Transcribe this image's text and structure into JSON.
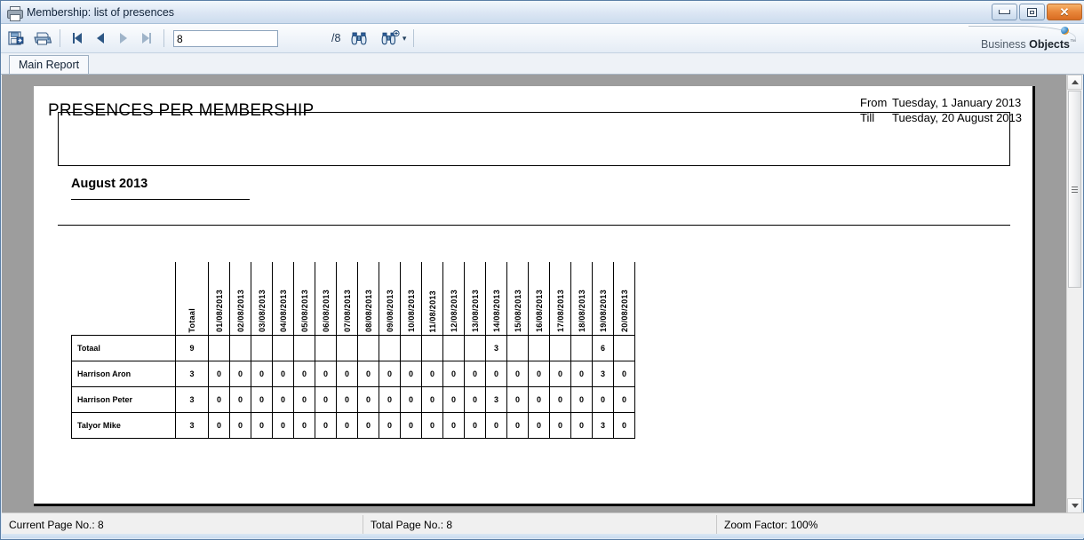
{
  "window": {
    "title": "Membership: list of presences",
    "icon": "printer-icon",
    "minimize_label": "Minimize",
    "maximize_label": "Maximize",
    "close_label": "Close"
  },
  "toolbar": {
    "export_label": "Export Report",
    "print_label": "Print Report",
    "first_page_label": "Go To First Page",
    "prev_page_label": "Go To Previous Page",
    "next_page_label": "Go To Next Page",
    "last_page_label": "Go To Last Page",
    "page_value": "8",
    "page_placeholder": "",
    "page_total": "/8",
    "search_label": "Search Text",
    "zoom_label": "Zoom",
    "zoom_caret": "▾",
    "brand_first": "Business ",
    "brand_second": "Objects",
    "brand_tm": "™"
  },
  "tabs": [
    {
      "label": "Main Report",
      "active": true
    }
  ],
  "report": {
    "title": "PRESENCES PER MEMBERSHIP",
    "from_label": "From",
    "from_value": "Tuesday, 1 January 2013",
    "till_label": "Till",
    "till_value": "Tuesday, 20 August 2013",
    "month_heading": "August 2013"
  },
  "table": {
    "row_header_label": "",
    "total_column": "Totaal",
    "date_columns": [
      "01/08/2013",
      "02/08/2013",
      "03/08/2013",
      "04/08/2013",
      "05/08/2013",
      "06/08/2013",
      "07/08/2013",
      "08/08/2013",
      "09/08/2013",
      "10/08/2013",
      "11/08/2013",
      "12/08/2013",
      "13/08/2013",
      "14/08/2013",
      "15/08/2013",
      "16/08/2013",
      "17/08/2013",
      "18/08/2013",
      "19/08/2013",
      "20/08/2013"
    ],
    "rows": [
      {
        "name": "Totaal",
        "total": "9",
        "values": [
          "",
          "",
          "",
          "",
          "",
          "",
          "",
          "",
          "",
          "",
          "",
          "",
          "",
          "3",
          "",
          "",
          "",
          "",
          "6",
          ""
        ]
      },
      {
        "name": "Harrison  Aron",
        "total": "3",
        "values": [
          "0",
          "0",
          "0",
          "0",
          "0",
          "0",
          "0",
          "0",
          "0",
          "0",
          "0",
          "0",
          "0",
          "0",
          "0",
          "0",
          "0",
          "0",
          "3",
          "0"
        ]
      },
      {
        "name": "Harrison  Peter",
        "total": "3",
        "values": [
          "0",
          "0",
          "0",
          "0",
          "0",
          "0",
          "0",
          "0",
          "0",
          "0",
          "0",
          "0",
          "0",
          "3",
          "0",
          "0",
          "0",
          "0",
          "0",
          "0"
        ]
      },
      {
        "name": "Talyor  Mike",
        "total": "3",
        "values": [
          "0",
          "0",
          "0",
          "0",
          "0",
          "0",
          "0",
          "0",
          "0",
          "0",
          "0",
          "0",
          "0",
          "0",
          "0",
          "0",
          "0",
          "0",
          "3",
          "0"
        ]
      }
    ]
  },
  "statusbar": {
    "current_page": "Current Page No.: 8",
    "total_page": "Total Page No.: 8",
    "zoom_factor": "Zoom Factor: 100%"
  },
  "scrollbar": {
    "up_label": "Scroll Up",
    "down_label": "Scroll Down",
    "thumb_label": "Vertical Scroll Thumb"
  },
  "colors": {
    "title_bar": "#dbe6f4",
    "close_button": "#e8863a",
    "viewer_background": "#9d9d9d",
    "page": "#ffffff",
    "status_bar": "#f0f0f0"
  }
}
